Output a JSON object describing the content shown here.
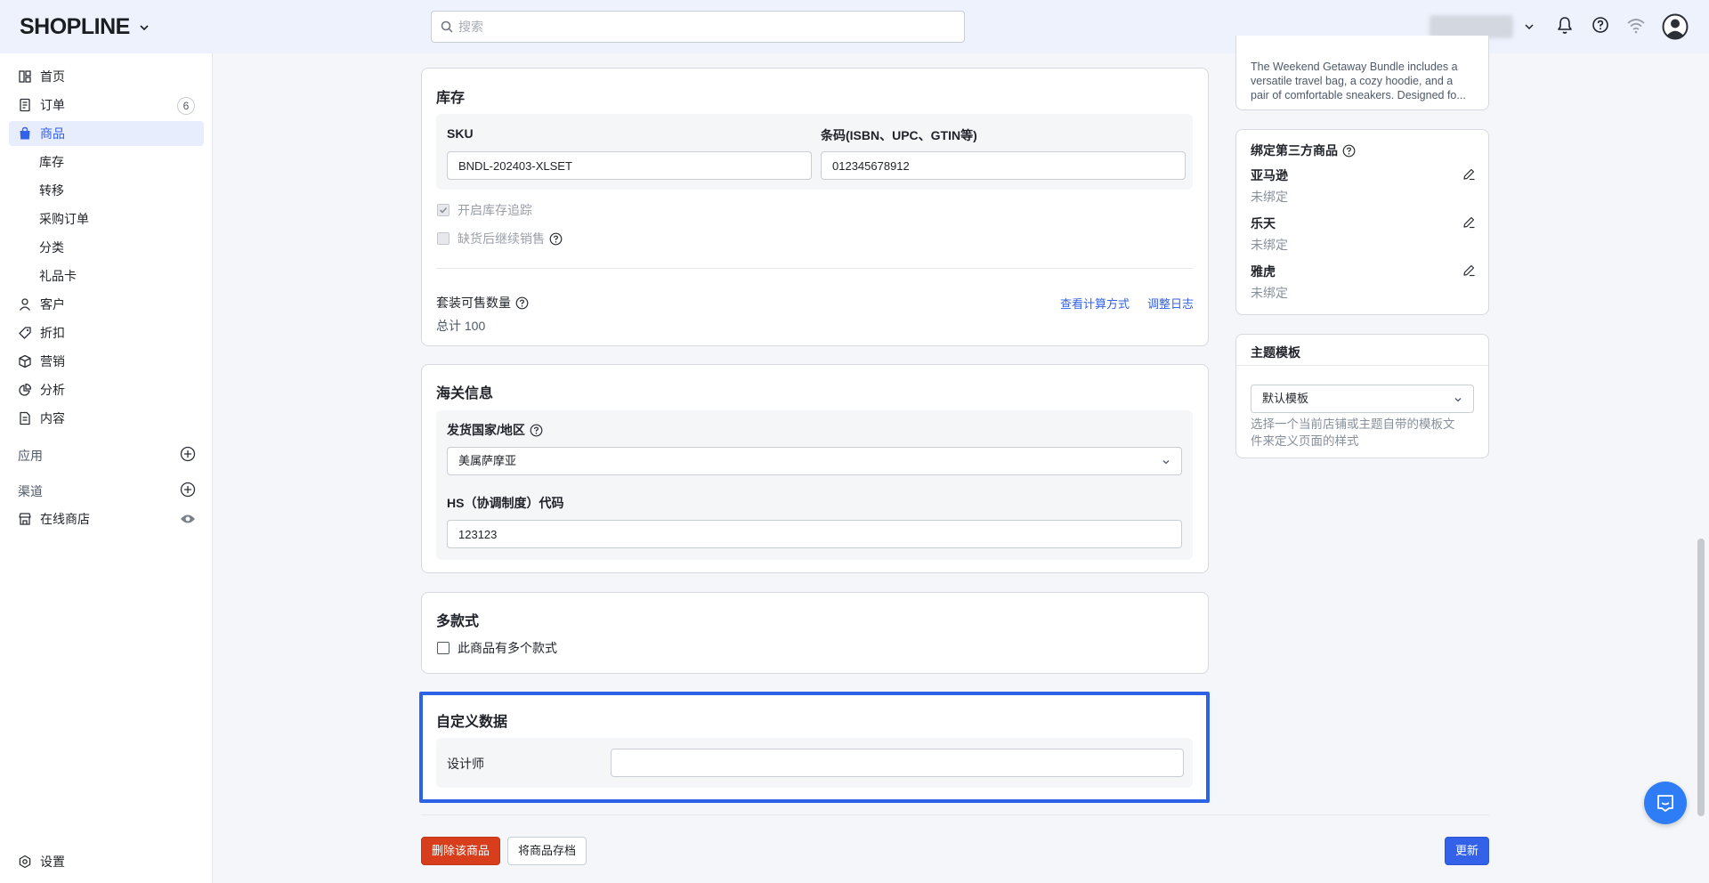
{
  "topbar": {
    "logo_text": "SHOPLINE",
    "search_placeholder": "搜索"
  },
  "sidebar": {
    "items": [
      {
        "label": "首页"
      },
      {
        "label": "订单",
        "badge": "6"
      },
      {
        "label": "商品"
      },
      {
        "label": "库存"
      },
      {
        "label": "转移"
      },
      {
        "label": "采购订单"
      },
      {
        "label": "分类"
      },
      {
        "label": "礼品卡"
      },
      {
        "label": "客户"
      },
      {
        "label": "折扣"
      },
      {
        "label": "营销"
      },
      {
        "label": "分析"
      },
      {
        "label": "内容"
      }
    ],
    "apps_label": "应用",
    "channels_label": "渠道",
    "online_store_label": "在线商店",
    "settings_label": "设置"
  },
  "inventory": {
    "title": "库存",
    "sku_label": "SKU",
    "sku_value": "BNDL-202403-XLSET",
    "barcode_label": "条码(ISBN、UPC、GTIN等)",
    "barcode_value": "012345678912",
    "track_label": "开启库存追踪",
    "continue_label": "缺货后继续销售",
    "bundle_qty_label": "套装可售数量",
    "view_calc_link": "查看计算方式",
    "adjust_log_link": "调整日志",
    "total_text": "总计 100"
  },
  "customs": {
    "title": "海关信息",
    "country_label": "发货国家/地区",
    "country_value": "美属萨摩亚",
    "hs_label": "HS（协调制度）代码",
    "hs_value": "123123"
  },
  "variants": {
    "title": "多款式",
    "checkbox_label": "此商品有多个款式"
  },
  "custom_data": {
    "title": "自定义数据",
    "designer_label": "设计师",
    "designer_value": ""
  },
  "actions": {
    "delete_label": "删除该商品",
    "archive_label": "将商品存档",
    "update_label": "更新"
  },
  "right": {
    "description_lines": [
      "The Weekend Getaway Bundle includes a",
      "versatile travel bag, a cozy hoodie, and a",
      "pair of comfortable sneakers. Designed fo..."
    ],
    "third_party_title": "绑定第三方商品",
    "platforms": [
      {
        "name": "亚马逊",
        "status": "未绑定"
      },
      {
        "name": "乐天",
        "status": "未绑定"
      },
      {
        "name": "雅虎",
        "status": "未绑定"
      }
    ],
    "theme_title": "主题模板",
    "theme_value": "默认模板",
    "theme_help_line1": "选择一个当前店铺或主题自带的模板文",
    "theme_help_line2": "件来定义页面的样式"
  }
}
